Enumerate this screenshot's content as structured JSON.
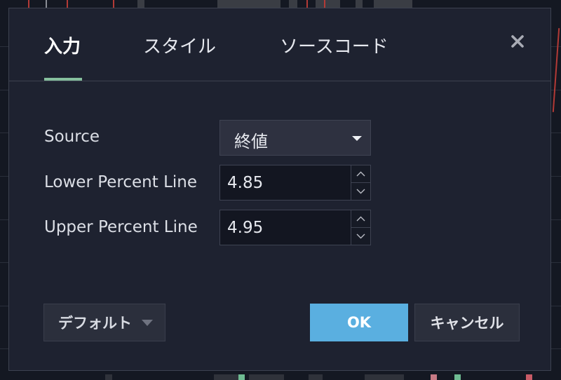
{
  "dialog": {
    "tabs": [
      {
        "label": "入力",
        "active": true
      },
      {
        "label": "スタイル",
        "active": false
      },
      {
        "label": "ソースコード",
        "active": false
      }
    ],
    "close_icon": "close-icon",
    "accent_color": "#86bf9d"
  },
  "fields": {
    "source": {
      "label": "Source",
      "value": "終値",
      "icon": "caret-down-icon"
    },
    "lower_percent_line": {
      "label": "Lower Percent Line",
      "value": "4.85"
    },
    "upper_percent_line": {
      "label": "Upper Percent Line",
      "value": "4.95"
    }
  },
  "footer": {
    "default_label": "デフォルト",
    "ok_label": "OK",
    "cancel_label": "キャンセル",
    "ok_color": "#5aafe0"
  }
}
